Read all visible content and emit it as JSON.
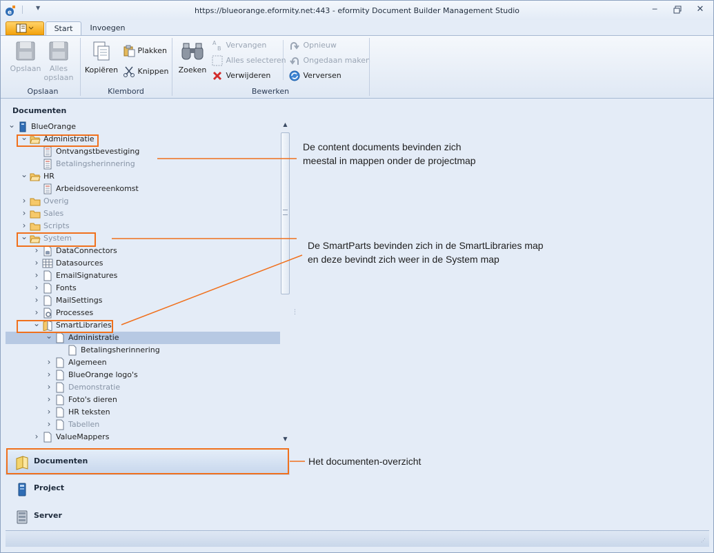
{
  "window": {
    "title": "https://blueorange.eformity.net:443 - eformity Document Builder Management Studio",
    "qat_icon": "chevron-down-icon",
    "controls": [
      "minimize-icon",
      "restore-icon",
      "close-icon"
    ]
  },
  "ribbon": {
    "tabs": [
      {
        "label": "Start",
        "active": true
      },
      {
        "label": "Invoegen",
        "active": false
      }
    ],
    "groups": {
      "opslaan": {
        "label": "Opslaan",
        "save": {
          "label": "Opslaan",
          "enabled": false
        },
        "save_all": {
          "line1": "Alles",
          "line2": "opslaan",
          "enabled": false
        }
      },
      "klembord": {
        "label": "Klembord",
        "copy": "Kopiëren",
        "paste": "Plakken",
        "cut": "Knippen"
      },
      "bewerken": {
        "label": "Bewerken",
        "search": "Zoeken",
        "replace": {
          "label": "Vervangen",
          "enabled": false
        },
        "select_all": {
          "label": "Alles selecteren",
          "enabled": false
        },
        "delete": "Verwijderen",
        "redo": {
          "label": "Opnieuw",
          "enabled": false
        },
        "undo": {
          "label": "Ongedaan maken",
          "enabled": false
        },
        "refresh": "Verversen"
      }
    }
  },
  "panel": {
    "title": "Documenten",
    "tree": [
      {
        "label": "BlueOrange",
        "level": 0,
        "expander": "expanded",
        "icon": "server-icon"
      },
      {
        "label": "Administratie",
        "level": 1,
        "expander": "expanded",
        "icon": "folder-open-icon"
      },
      {
        "label": "Ontvangstbevestiging",
        "level": 2,
        "expander": "none",
        "icon": "document-icon"
      },
      {
        "label": "Betalingsherinnering",
        "level": 2,
        "expander": "none",
        "icon": "document-icon",
        "dim": true
      },
      {
        "label": "HR",
        "level": 1,
        "expander": "expanded",
        "icon": "folder-open-icon"
      },
      {
        "label": "Arbeidsovereenkomst",
        "level": 2,
        "expander": "none",
        "icon": "document-icon"
      },
      {
        "label": "Overig",
        "level": 1,
        "expander": "collapsed",
        "icon": "folder-icon",
        "dim": true
      },
      {
        "label": "Sales",
        "level": 1,
        "expander": "collapsed",
        "icon": "folder-icon",
        "dim": true
      },
      {
        "label": "Scripts",
        "level": 1,
        "expander": "collapsed",
        "icon": "folder-icon",
        "dim": true
      },
      {
        "label": "System",
        "level": 1,
        "expander": "expanded",
        "icon": "folder-open-icon",
        "dim": true
      },
      {
        "label": "DataConnectors",
        "level": 2,
        "expander": "collapsed",
        "icon": "data-connector-icon"
      },
      {
        "label": "Datasources",
        "level": 2,
        "expander": "collapsed",
        "icon": "grid-icon"
      },
      {
        "label": "EmailSignatures",
        "level": 2,
        "expander": "collapsed",
        "icon": "page-icon"
      },
      {
        "label": "Fonts",
        "level": 2,
        "expander": "collapsed",
        "icon": "page-icon"
      },
      {
        "label": "MailSettings",
        "level": 2,
        "expander": "collapsed",
        "icon": "page-icon"
      },
      {
        "label": "Processes",
        "level": 2,
        "expander": "collapsed",
        "icon": "process-icon"
      },
      {
        "label": "SmartLibraries",
        "level": 2,
        "expander": "expanded",
        "icon": "library-icon"
      },
      {
        "label": "Administratie",
        "level": 3,
        "expander": "expanded",
        "icon": "page-icon",
        "selected": true
      },
      {
        "label": "Betalingsherinnering",
        "level": 4,
        "expander": "none",
        "icon": "page-icon"
      },
      {
        "label": "Algemeen",
        "level": 3,
        "expander": "collapsed",
        "icon": "page-icon"
      },
      {
        "label": "BlueOrange logo's",
        "level": 3,
        "expander": "collapsed",
        "icon": "page-icon"
      },
      {
        "label": "Demonstratie",
        "level": 3,
        "expander": "collapsed",
        "icon": "page-icon",
        "dim": true
      },
      {
        "label": "Foto's dieren",
        "level": 3,
        "expander": "collapsed",
        "icon": "page-icon"
      },
      {
        "label": "HR teksten",
        "level": 3,
        "expander": "collapsed",
        "icon": "page-icon"
      },
      {
        "label": "Tabellen",
        "level": 3,
        "expander": "collapsed",
        "icon": "page-icon",
        "dim": true
      },
      {
        "label": "ValueMappers",
        "level": 2,
        "expander": "collapsed",
        "icon": "page-icon"
      }
    ]
  },
  "nav": {
    "documenten": "Documenten",
    "project": "Project",
    "server": "Server"
  },
  "annotations": {
    "content_docs_line1": "De content documents bevinden zich",
    "content_docs_line2": "meestal in mappen onder de projectmap",
    "smartparts_line1": "De SmartParts bevinden zich in de SmartLibraries map",
    "smartparts_line2": "en deze bevindt zich weer in de System map",
    "overview": "Het documenten-overzicht",
    "color": "#f0701c"
  }
}
